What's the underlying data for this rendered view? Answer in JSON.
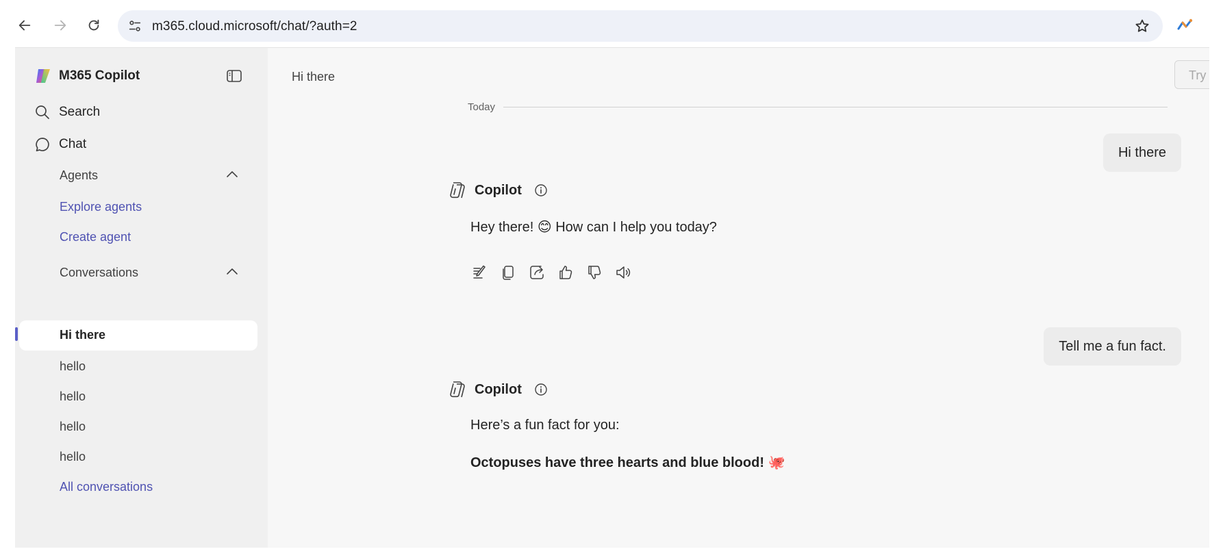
{
  "browser": {
    "url": "m365.cloud.microsoft/chat/?auth=2"
  },
  "sidebar": {
    "app_name": "M365 Copilot",
    "nav": [
      {
        "label": "Search",
        "icon": "search-icon"
      },
      {
        "label": "Chat",
        "icon": "chat-icon"
      }
    ],
    "agents": {
      "label": "Agents",
      "links": [
        "Explore agents",
        "Create agent"
      ]
    },
    "conversations": {
      "label": "Conversations",
      "items": [
        "Hi there",
        "hello",
        "hello",
        "hello",
        "hello"
      ],
      "active_index": 0,
      "all_link": "All conversations"
    }
  },
  "main": {
    "title": "Hi there",
    "try_button": "Try G",
    "day_separator": "Today",
    "messages": [
      {
        "role": "user",
        "text": "Hi there"
      },
      {
        "role": "assistant",
        "name": "Copilot",
        "lines": [
          "Hey there! 😊 How can I help you today?"
        ]
      },
      {
        "role": "user",
        "text": "Tell me a fun fact."
      },
      {
        "role": "assistant",
        "name": "Copilot",
        "lines": [
          "Here’s a fun fact for you:",
          "Octopuses have three hearts and blue blood! 🐙"
        ]
      }
    ]
  },
  "colors": {
    "accent": "#5b5fc7",
    "link": "#4f52b2",
    "sidebar_bg": "#f0f0f0",
    "main_bg": "#f7f7f7",
    "address_bar_bg": "#eef1f8"
  }
}
